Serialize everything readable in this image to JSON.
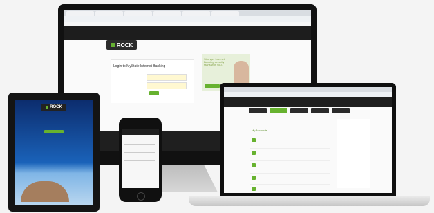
{
  "brand": {
    "name": "ROCK",
    "accent": "#67b22f",
    "dark": "#1f1f1f"
  },
  "monitor": {
    "login_title": "Login to MyState Internet Banking",
    "fields": {
      "customer_number_label": "Customer number",
      "password_label": "Password"
    },
    "promo_lines": [
      "Stronger Internet",
      "Banking security",
      "starts with you."
    ]
  },
  "laptop": {
    "accounts_title": "My Accounts",
    "nav_labels": [
      "Accounts",
      "Transfer & Pay",
      "Manage",
      "Messages"
    ]
  }
}
